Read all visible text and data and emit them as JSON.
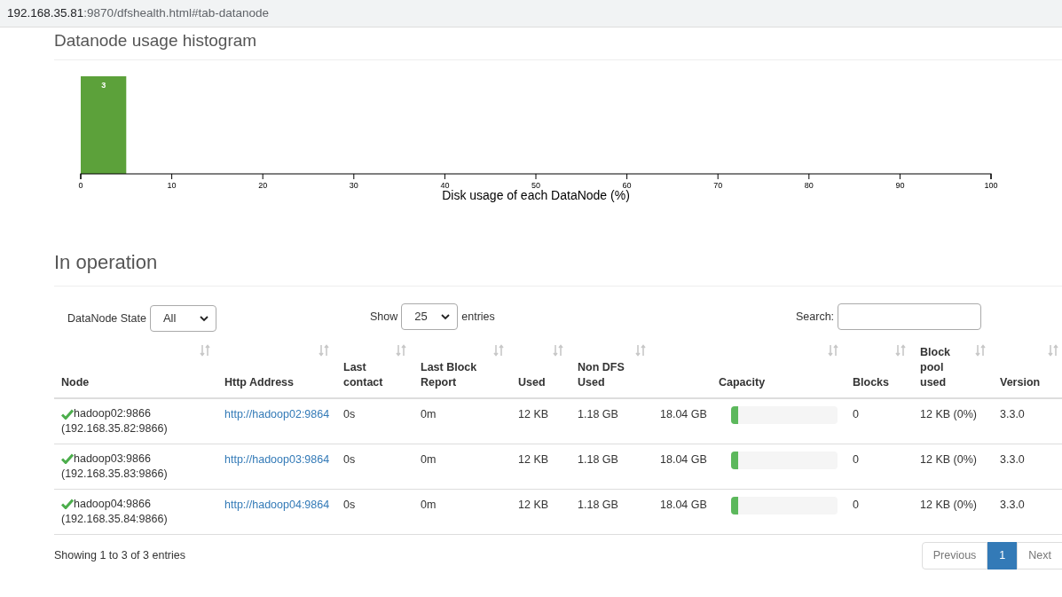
{
  "address_bar": {
    "host": "192.168.35.81",
    "path": ":9870/dfshealth.html#tab-datanode"
  },
  "histogram": {
    "title": "Datanode usage histogram",
    "chart_data": {
      "type": "bar",
      "x": [
        2.5
      ],
      "values": [
        3
      ],
      "xlim": [
        0,
        100
      ],
      "ylim": [
        0,
        3
      ],
      "xticks": [
        0,
        10,
        20,
        30,
        40,
        50,
        60,
        70,
        80,
        90,
        100
      ],
      "xlabel": "Disk usage of each DataNode (%)",
      "data_labels": true,
      "color": "#5ca13a"
    }
  },
  "in_operation": {
    "title": "In operation",
    "state_filter": {
      "label": "DataNode State",
      "value": "All"
    },
    "page_length": {
      "label_before": "Show",
      "value": "25",
      "label_after": "entries"
    },
    "search": {
      "label": "Search:"
    },
    "columns": [
      {
        "label": "Node"
      },
      {
        "label": "Http Address"
      },
      {
        "label": "Last contact"
      },
      {
        "label": "Last Block Report"
      },
      {
        "label": "Used"
      },
      {
        "label": "Non DFS Used"
      },
      {
        "label": "Capacity"
      },
      {
        "label": "Blocks"
      },
      {
        "label": "Block pool used"
      },
      {
        "label": "Version"
      }
    ],
    "rows": [
      {
        "in_service": true,
        "node": "hadoop02:9866",
        "address": "(192.168.35.82:9866)",
        "http": "http://hadoop02:9864",
        "last_contact": "0s",
        "last_block_report": "0m",
        "used": "12 KB",
        "non_dfs_used": "1.18 GB",
        "capacity": "18.04 GB",
        "level": 0.02,
        "blocks": "0",
        "block_pool_used": "12 KB (0%)",
        "version": "3.3.0"
      },
      {
        "in_service": true,
        "node": "hadoop03:9866",
        "address": "(192.168.35.83:9866)",
        "http": "http://hadoop03:9864",
        "last_contact": "0s",
        "last_block_report": "0m",
        "used": "12 KB",
        "non_dfs_used": "1.18 GB",
        "capacity": "18.04 GB",
        "level": 0.02,
        "blocks": "0",
        "block_pool_used": "12 KB (0%)",
        "version": "3.3.0"
      },
      {
        "in_service": true,
        "node": "hadoop04:9866",
        "address": "(192.168.35.84:9866)",
        "http": "http://hadoop04:9864",
        "last_contact": "0s",
        "last_block_report": "0m",
        "used": "12 KB",
        "non_dfs_used": "1.18 GB",
        "capacity": "18.04 GB",
        "level": 0.02,
        "blocks": "0",
        "block_pool_used": "12 KB (0%)",
        "version": "3.3.0"
      }
    ],
    "info": "Showing 1 to 3 of 3 entries",
    "pagination": [
      {
        "label": "Previous",
        "disabled": true,
        "selected": false
      },
      {
        "label": "1",
        "disabled": false,
        "selected": true
      },
      {
        "label": "Next",
        "disabled": true,
        "selected": false
      }
    ]
  }
}
